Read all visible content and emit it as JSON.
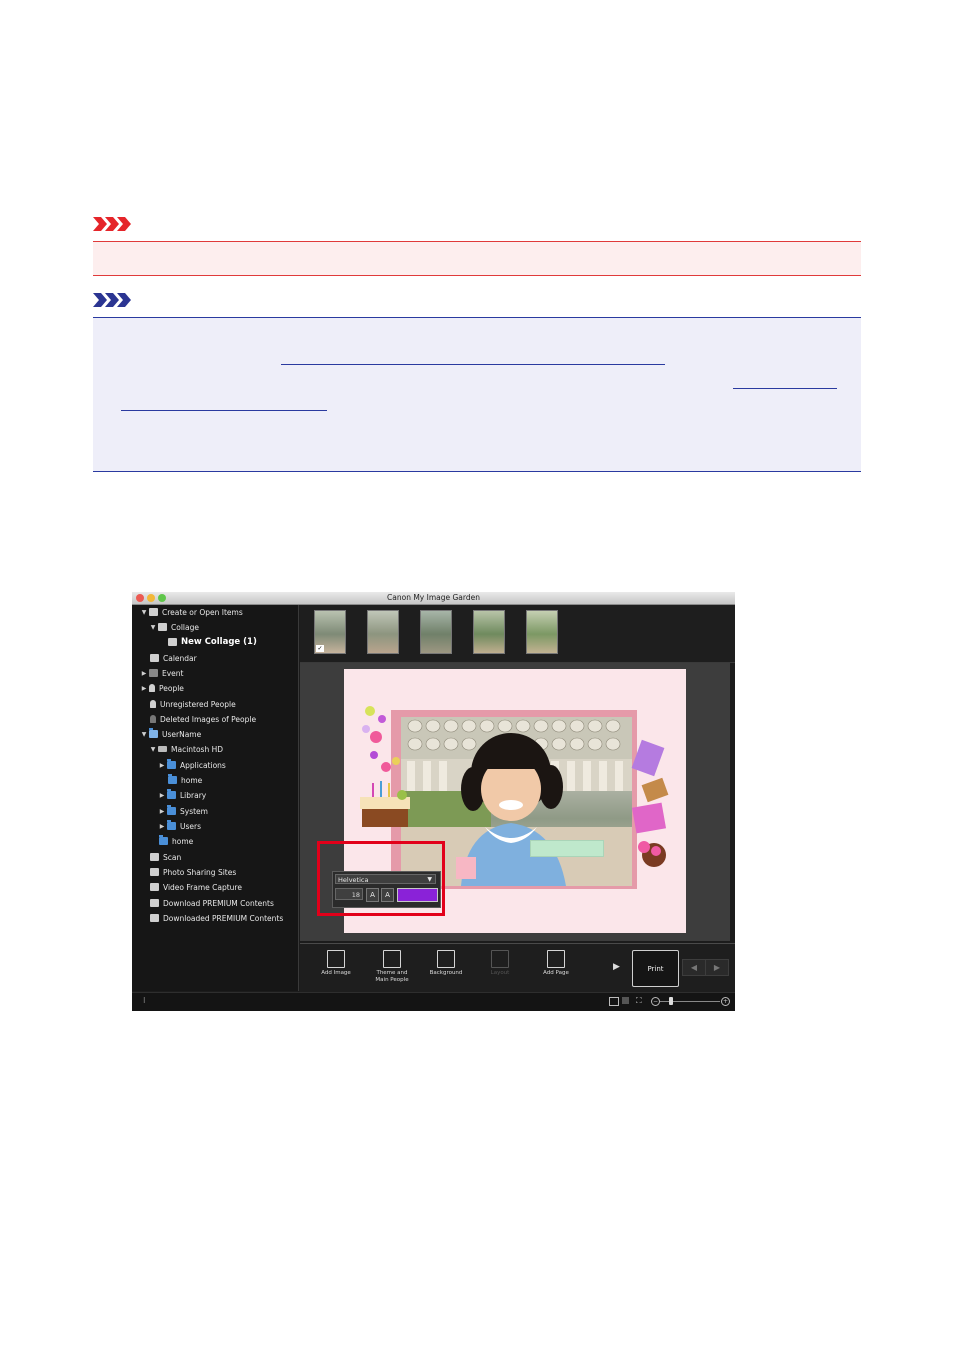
{
  "app": {
    "window_title": "Canon My Image Garden",
    "sidebar": {
      "items": [
        {
          "label": "Create or Open Items",
          "indent": 0,
          "arrow": "▼",
          "icon": "create-icon"
        },
        {
          "label": "Collage",
          "indent": 1,
          "arrow": "▼",
          "icon": "collage-icon"
        },
        {
          "label": "New Collage (1)",
          "indent": 2,
          "arrow": "",
          "icon": "collage-doc-icon",
          "selected": true
        },
        {
          "label": "Calendar",
          "indent": 0,
          "arrow": "",
          "icon": "calendar-icon"
        },
        {
          "label": "Event",
          "indent": 0,
          "arrow": "▶",
          "icon": "event-icon"
        },
        {
          "label": "People",
          "indent": 0,
          "arrow": "▶",
          "icon": "people-icon"
        },
        {
          "label": "Unregistered People",
          "indent": 0,
          "arrow": "",
          "icon": "unregistered-person-icon"
        },
        {
          "label": "Deleted Images of People",
          "indent": 0,
          "arrow": "",
          "icon": "deleted-person-icon"
        },
        {
          "label": "UserName",
          "indent": 0,
          "arrow": "▼",
          "icon": "computer-icon"
        },
        {
          "label": "Macintosh HD",
          "indent": 1,
          "arrow": "▼",
          "icon": "drive-icon"
        },
        {
          "label": "Applications",
          "indent": 2,
          "arrow": "▶",
          "icon": "folder-icon"
        },
        {
          "label": "home",
          "indent": 2,
          "arrow": "",
          "icon": "home-icon"
        },
        {
          "label": "Library",
          "indent": 2,
          "arrow": "▶",
          "icon": "folder-icon"
        },
        {
          "label": "System",
          "indent": 2,
          "arrow": "▶",
          "icon": "folder-icon"
        },
        {
          "label": "Users",
          "indent": 2,
          "arrow": "▶",
          "icon": "folder-icon"
        },
        {
          "label": "home",
          "indent": 1,
          "arrow": "",
          "icon": "home-icon"
        },
        {
          "label": "Scan",
          "indent": 0,
          "arrow": "",
          "icon": "scan-icon"
        },
        {
          "label": "Photo Sharing Sites",
          "indent": 0,
          "arrow": "",
          "icon": "photo-sharing-icon"
        },
        {
          "label": "Video Frame Capture",
          "indent": 0,
          "arrow": "",
          "icon": "video-icon"
        },
        {
          "label": "Download PREMIUM Contents",
          "indent": 0,
          "arrow": "",
          "icon": "download-icon"
        },
        {
          "label": "Downloaded PREMIUM Contents",
          "indent": 0,
          "arrow": "",
          "icon": "downloaded-icon"
        }
      ]
    },
    "toolbar": {
      "add_image": "Add Image",
      "theme_main_people_1": "Theme and",
      "theme_main_people_2": "Main People",
      "background": "Background",
      "layout": "Layout",
      "add_page": "Add Page",
      "print": "Print"
    },
    "text_panel": {
      "font": "Helvetica",
      "size": "18",
      "color": "#8a22d8"
    }
  }
}
